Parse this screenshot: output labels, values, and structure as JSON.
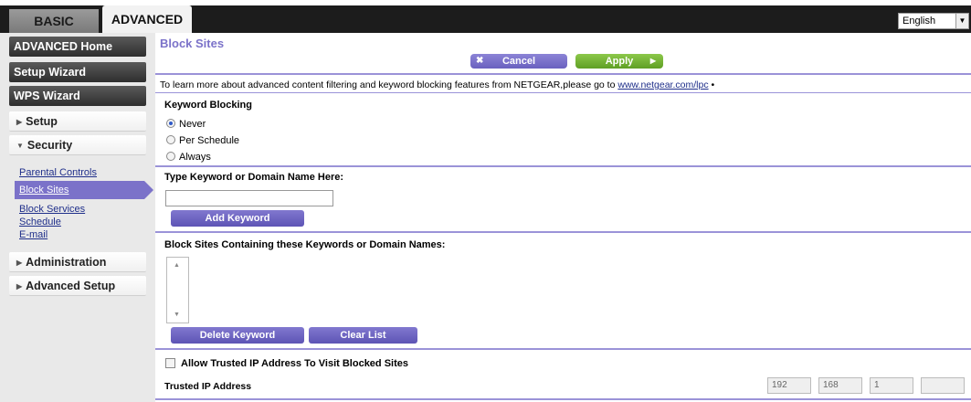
{
  "tabs": {
    "basic": "BASIC",
    "advanced": "ADVANCED"
  },
  "language": {
    "selected": "English"
  },
  "sidebar": {
    "advanced_home": "ADVANCED Home",
    "setup_wizard": "Setup Wizard",
    "wps_wizard": "WPS Wizard",
    "setup": "Setup",
    "security": "Security",
    "sub": [
      "Parental Controls",
      "Block Sites",
      "Block Services",
      "Schedule",
      "E-mail"
    ],
    "administration": "Administration",
    "advanced_setup": "Advanced Setup"
  },
  "main": {
    "title": "Block Sites",
    "cancel": "Cancel",
    "apply": "Apply",
    "intro_text": "To learn more about advanced content filtering and keyword blocking features from NETGEAR,please go to ",
    "intro_link": "www.netgear.com/lpc",
    "intro_tail": " •",
    "keyword_blocking": "Keyword Blocking",
    "options": [
      "Never",
      "Per Schedule",
      "Always"
    ],
    "selected_option": "Never",
    "type_keyword": "Type Keyword or Domain Name Here:",
    "keyword_value": "",
    "add_keyword": "Add Keyword",
    "block_list_heading": "Block Sites Containing these Keywords or Domain Names:",
    "delete_keyword": "Delete Keyword",
    "clear_list": "Clear List",
    "allow_trusted": "Allow Trusted IP Address To Visit Blocked Sites",
    "trusted_ip_label": "Trusted IP Address",
    "trusted_ip": [
      "192",
      "168",
      "1",
      ""
    ]
  },
  "colors": {
    "accent": "#7b72c9",
    "apply": "#6fb033",
    "nav_dark": "#3a3a3a"
  }
}
